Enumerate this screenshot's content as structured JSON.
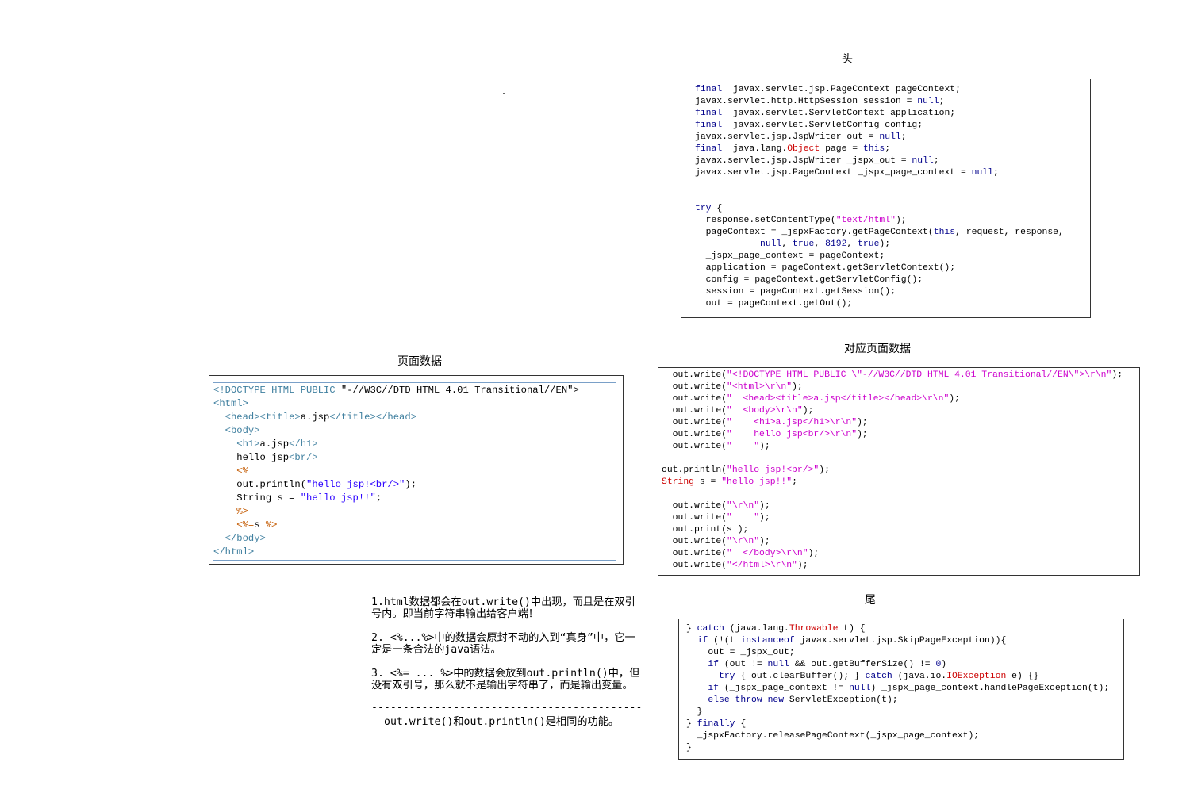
{
  "titles": {
    "head": "头",
    "page_data": "页面数据",
    "mapped_page_data": "对应页面数据",
    "tail": "尾"
  },
  "head_code": [
    [
      [
        "kw",
        "final"
      ],
      [
        "",
        "  javax.servlet.jsp.PageContext pageContext;"
      ]
    ],
    [
      [
        "",
        "javax.servlet.http.HttpSession session = "
      ],
      [
        "kw",
        "null"
      ],
      [
        "",
        ";"
      ]
    ],
    [
      [
        "kw",
        "final"
      ],
      [
        "",
        "  javax.servlet.ServletContext application;"
      ]
    ],
    [
      [
        "kw",
        "final"
      ],
      [
        "",
        "  javax.servlet.ServletConfig config;"
      ]
    ],
    [
      [
        "",
        "javax.servlet.jsp.JspWriter out = "
      ],
      [
        "kw",
        "null"
      ],
      [
        "",
        ";"
      ]
    ],
    [
      [
        "kw",
        "final"
      ],
      [
        "",
        "  java.lang."
      ],
      [
        "cls",
        "Object"
      ],
      [
        "",
        " page = "
      ],
      [
        "kw",
        "this"
      ],
      [
        "",
        ";"
      ]
    ],
    [
      [
        "",
        "javax.servlet.jsp.JspWriter _jspx_out = "
      ],
      [
        "kw",
        "null"
      ],
      [
        "",
        ";"
      ]
    ],
    [
      [
        "",
        "javax.servlet.jsp.PageContext _jspx_page_context = "
      ],
      [
        "kw",
        "null"
      ],
      [
        "",
        ";"
      ]
    ],
    [],
    [],
    [
      [
        "kw",
        "try"
      ],
      [
        "",
        " {"
      ]
    ],
    [
      [
        "",
        "  response.setContentType("
      ],
      [
        "str",
        "\"text/html\""
      ],
      [
        "",
        ");"
      ]
    ],
    [
      [
        "",
        "  pageContext = _jspxFactory.getPageContext("
      ],
      [
        "kw",
        "this"
      ],
      [
        "",
        ", request, response,"
      ]
    ],
    [
      [
        "",
        "            "
      ],
      [
        "kw",
        "null"
      ],
      [
        "",
        ", "
      ],
      [
        "kw",
        "true"
      ],
      [
        "",
        ", "
      ],
      [
        "kw",
        "8192"
      ],
      [
        "",
        ", "
      ],
      [
        "kw",
        "true"
      ],
      [
        "",
        ");"
      ]
    ],
    [
      [
        "",
        "  _jspx_page_context = pageContext;"
      ]
    ],
    [
      [
        "",
        "  application = pageContext.getServletContext();"
      ]
    ],
    [
      [
        "",
        "  config = pageContext.getServletConfig();"
      ]
    ],
    [
      [
        "",
        "  session = pageContext.getSession();"
      ]
    ],
    [
      [
        "",
        "  out = pageContext.getOut();"
      ]
    ]
  ],
  "page_data_code": [
    [
      [
        "tag",
        "<!DOCTYPE HTML PUBLIC "
      ],
      [
        "",
        "\"-//W3C//DTD HTML 4.01 Transitional//EN\">"
      ]
    ],
    [
      [
        "tag",
        "<html>"
      ]
    ],
    [
      [
        "",
        "  "
      ],
      [
        "tag",
        "<head><title>"
      ],
      [
        "",
        "a.jsp"
      ],
      [
        "tag",
        "</title></head>"
      ]
    ],
    [
      [
        "",
        "  "
      ],
      [
        "tag",
        "<body>"
      ]
    ],
    [
      [
        "",
        "    "
      ],
      [
        "tag",
        "<h1>"
      ],
      [
        "",
        "a.jsp"
      ],
      [
        "tag",
        "</h1>"
      ]
    ],
    [
      [
        "",
        "    hello jsp"
      ],
      [
        "tag",
        "<br/>"
      ]
    ],
    [
      [
        "",
        "    "
      ],
      [
        "jsp",
        "<%"
      ]
    ],
    [
      [
        "",
        "    out.println("
      ],
      [
        "jstr",
        "\"hello jsp!<br/>\""
      ],
      [
        "",
        ");"
      ]
    ],
    [
      [
        "",
        "    String s = "
      ],
      [
        "jstr",
        "\"hello jsp!!\""
      ],
      [
        "",
        ";"
      ]
    ],
    [
      [
        "",
        "    "
      ],
      [
        "jsp",
        "%>"
      ]
    ],
    [
      [
        "",
        "    "
      ],
      [
        "jsp",
        "<%="
      ],
      [
        "",
        "s "
      ],
      [
        "jsp",
        "%>"
      ]
    ],
    [
      [
        "",
        "  "
      ],
      [
        "tag",
        "</body>"
      ]
    ],
    [
      [
        "tag",
        "</html>"
      ]
    ]
  ],
  "mapped_code": [
    [
      [
        "",
        "  out.write("
      ],
      [
        "str",
        "\"<!DOCTYPE HTML PUBLIC \\\"-//W3C//DTD HTML 4.01 Transitional//EN\\\">\\r\\n\""
      ],
      [
        "",
        ");"
      ]
    ],
    [
      [
        "",
        "  out.write("
      ],
      [
        "str",
        "\"<html>\\r\\n\""
      ],
      [
        "",
        ");"
      ]
    ],
    [
      [
        "",
        "  out.write("
      ],
      [
        "str",
        "\"  <head><title>a.jsp</title></head>\\r\\n\""
      ],
      [
        "",
        ");"
      ]
    ],
    [
      [
        "",
        "  out.write("
      ],
      [
        "str",
        "\"  <body>\\r\\n\""
      ],
      [
        "",
        ");"
      ]
    ],
    [
      [
        "",
        "  out.write("
      ],
      [
        "str",
        "\"    <h1>a.jsp</h1>\\r\\n\""
      ],
      [
        "",
        ");"
      ]
    ],
    [
      [
        "",
        "  out.write("
      ],
      [
        "str",
        "\"    hello jsp<br/>\\r\\n\""
      ],
      [
        "",
        ");"
      ]
    ],
    [
      [
        "",
        "  out.write("
      ],
      [
        "str",
        "\"    \""
      ],
      [
        "",
        ");"
      ]
    ],
    [],
    [
      [
        "",
        "out.println("
      ],
      [
        "str",
        "\"hello jsp!<br/>\""
      ],
      [
        "",
        ");"
      ]
    ],
    [
      [
        "cls",
        "String"
      ],
      [
        "",
        " s = "
      ],
      [
        "str",
        "\"hello jsp!!\""
      ],
      [
        "",
        ";"
      ]
    ],
    [],
    [
      [
        "",
        "  out.write("
      ],
      [
        "str",
        "\"\\r\\n\""
      ],
      [
        "",
        ");"
      ]
    ],
    [
      [
        "",
        "  out.write("
      ],
      [
        "str",
        "\"    \""
      ],
      [
        "",
        ");"
      ]
    ],
    [
      [
        "",
        "  out.print(s );"
      ]
    ],
    [
      [
        "",
        "  out.write("
      ],
      [
        "str",
        "\"\\r\\n\""
      ],
      [
        "",
        ");"
      ]
    ],
    [
      [
        "",
        "  out.write("
      ],
      [
        "str",
        "\"  </body>\\r\\n\""
      ],
      [
        "",
        ");"
      ]
    ],
    [
      [
        "",
        "  out.write("
      ],
      [
        "str",
        "\"</html>\\r\\n\""
      ],
      [
        "",
        ");"
      ]
    ]
  ],
  "tail_code": [
    [
      [
        "",
        "} "
      ],
      [
        "kw",
        "catch"
      ],
      [
        "",
        " (java.lang."
      ],
      [
        "cls",
        "Throwable"
      ],
      [
        "",
        " t) {"
      ]
    ],
    [
      [
        "",
        "  "
      ],
      [
        "kw",
        "if"
      ],
      [
        "",
        " (!(t "
      ],
      [
        "kw",
        "instanceof"
      ],
      [
        "",
        " javax.servlet.jsp.SkipPageException)){"
      ]
    ],
    [
      [
        "",
        "    out = _jspx_out;"
      ]
    ],
    [
      [
        "",
        "    "
      ],
      [
        "kw",
        "if"
      ],
      [
        "",
        " (out != "
      ],
      [
        "kw",
        "null"
      ],
      [
        "",
        " && out.getBufferSize() != "
      ],
      [
        "kw",
        "0"
      ],
      [
        "",
        ")"
      ]
    ],
    [
      [
        "",
        "      "
      ],
      [
        "kw",
        "try"
      ],
      [
        "",
        " { out.clearBuffer(); } "
      ],
      [
        "kw",
        "catch"
      ],
      [
        "",
        " (java.io."
      ],
      [
        "cls",
        "IOException"
      ],
      [
        "",
        " e) {}"
      ]
    ],
    [
      [
        "",
        "    "
      ],
      [
        "kw",
        "if"
      ],
      [
        "",
        " (_jspx_page_context != "
      ],
      [
        "kw",
        "null"
      ],
      [
        "",
        ") _jspx_page_context.handlePageException(t);"
      ]
    ],
    [
      [
        "",
        "    "
      ],
      [
        "kw",
        "else"
      ],
      [
        "",
        " "
      ],
      [
        "kw",
        "throw"
      ],
      [
        "",
        " "
      ],
      [
        "kw",
        "new"
      ],
      [
        "",
        " ServletException(t);"
      ]
    ],
    [
      [
        "",
        "  }"
      ]
    ],
    [
      [
        "",
        "} "
      ],
      [
        "kw",
        "finally"
      ],
      [
        "",
        " {"
      ]
    ],
    [
      [
        "",
        "  _jspxFactory.releasePageContext(_jspx_page_context);"
      ]
    ],
    [
      [
        "",
        "}"
      ]
    ]
  ],
  "notes": {
    "n1": "1.html数据都会在out.write()中出现，而且是在双引号内。即当前字符串输出给客户端！",
    "n2": "2. <%...%>中的数据会原封不动的入到“真身”中，它一定是一条合法的java语法。",
    "n3": "3. <%= ... %>中的数据会放到out.println()中，但没有双引号，那么就不是输出字符串了，而是输出变量。",
    "rule": "------------------------------------------------",
    "summary": "out.write()和out.println()是相同的功能。"
  }
}
